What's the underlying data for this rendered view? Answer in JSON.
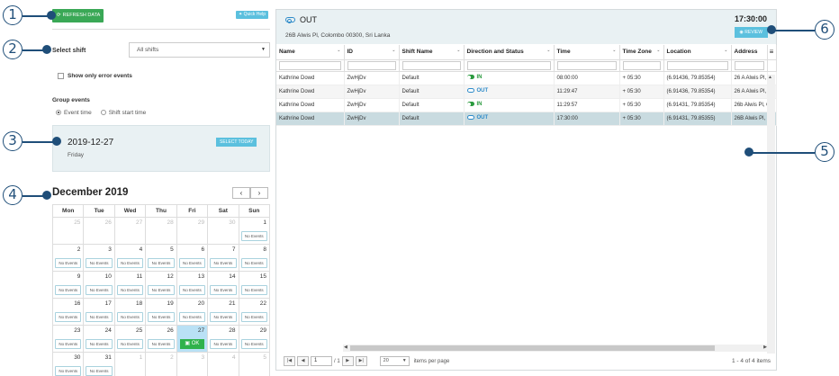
{
  "callouts": [
    "1",
    "2",
    "3",
    "4",
    "5",
    "6"
  ],
  "left": {
    "refresh_label": "REFRESH DATA",
    "quick_help_label": "Quick Help",
    "select_shift_label": "Select shift",
    "select_shift_value": "All shifts",
    "show_errors_label": "Show only error events",
    "group_events_label": "Group events",
    "radio_event_time": "Event time",
    "radio_shift_start": "Shift start time",
    "selected_date": "2019-12-27",
    "selected_weekday": "Friday",
    "select_today_label": "SELECT TODAY"
  },
  "calendar": {
    "title": "December 2019",
    "prev_label": "‹",
    "next_label": "›",
    "weekdays": [
      "Mon",
      "Tue",
      "Wed",
      "Thu",
      "Fri",
      "Sat",
      "Sun"
    ],
    "no_events_label": "No Events",
    "ok_label": "OK",
    "weeks": [
      [
        {
          "d": "25",
          "out": true
        },
        {
          "d": "26",
          "out": true
        },
        {
          "d": "27",
          "out": true
        },
        {
          "d": "28",
          "out": true
        },
        {
          "d": "29",
          "out": true
        },
        {
          "d": "30",
          "out": true
        },
        {
          "d": "1",
          "ne": true
        }
      ],
      [
        {
          "d": "2",
          "ne": true
        },
        {
          "d": "3",
          "ne": true
        },
        {
          "d": "4",
          "ne": true
        },
        {
          "d": "5",
          "ne": true
        },
        {
          "d": "6",
          "ne": true
        },
        {
          "d": "7",
          "ne": true
        },
        {
          "d": "8",
          "ne": true
        }
      ],
      [
        {
          "d": "9",
          "ne": true
        },
        {
          "d": "10",
          "ne": true
        },
        {
          "d": "11",
          "ne": true
        },
        {
          "d": "12",
          "ne": true
        },
        {
          "d": "13",
          "ne": true
        },
        {
          "d": "14",
          "ne": true
        },
        {
          "d": "15",
          "ne": true
        }
      ],
      [
        {
          "d": "16",
          "ne": true
        },
        {
          "d": "17",
          "ne": true
        },
        {
          "d": "18",
          "ne": true
        },
        {
          "d": "19",
          "ne": true
        },
        {
          "d": "20",
          "ne": true
        },
        {
          "d": "21",
          "ne": true
        },
        {
          "d": "22",
          "ne": true
        }
      ],
      [
        {
          "d": "23",
          "ne": true
        },
        {
          "d": "24",
          "ne": true
        },
        {
          "d": "25",
          "ne": true
        },
        {
          "d": "26",
          "ne": true
        },
        {
          "d": "27",
          "sel": true,
          "ok": true
        },
        {
          "d": "28",
          "ne": true
        },
        {
          "d": "29",
          "ne": true
        }
      ],
      [
        {
          "d": "30",
          "ne": true
        },
        {
          "d": "31",
          "ne": true
        },
        {
          "d": "1",
          "out": true
        },
        {
          "d": "2",
          "out": true
        },
        {
          "d": "3",
          "out": true
        },
        {
          "d": "4",
          "out": true
        },
        {
          "d": "5",
          "out": true
        }
      ]
    ]
  },
  "detail": {
    "status": "OUT",
    "address": "26B Alwis Pl, Colombo 00300, Sri Lanka",
    "time": "17:30:00",
    "review_label": "REVIEW"
  },
  "grid": {
    "columns": [
      "Name",
      "ID",
      "Shift Name",
      "Direction and Status",
      "Time",
      "Time Zone",
      "Location",
      "Address"
    ],
    "menu_icon": "≡",
    "rows": [
      {
        "name": "Kathrine Dowd",
        "id": "ZwHjDv",
        "shift": "Default",
        "dir": "IN",
        "time": "08:00:00",
        "tz": "+ 05:30",
        "loc": "(6.91436, 79.85354)",
        "addr": "26 A Alwis Pl, C"
      },
      {
        "name": "Kathrine Dowd",
        "id": "ZwHjDv",
        "shift": "Default",
        "dir": "OUT",
        "time": "11:29:47",
        "tz": "+ 05:30",
        "loc": "(6.91436, 79.85354)",
        "addr": "26 A Alwis Pl, C"
      },
      {
        "name": "Kathrine Dowd",
        "id": "ZwHjDv",
        "shift": "Default",
        "dir": "IN",
        "time": "11:29:57",
        "tz": "+ 05:30",
        "loc": "(6.91431, 79.85354)",
        "addr": "26b Alwis Pl, C"
      },
      {
        "name": "Kathrine Dowd",
        "id": "ZwHjDv",
        "shift": "Default",
        "dir": "OUT",
        "time": "17:30:00",
        "tz": "+ 05:30",
        "loc": "(6.91431, 79.85355)",
        "addr": "26B Alwis Pl, C"
      }
    ]
  },
  "pager": {
    "first": "|◀",
    "prev": "◀",
    "page": "1",
    "of": "/ 1",
    "next": "▶",
    "last": "▶|",
    "page_size": "20",
    "per_page_label": "items per page",
    "info": "1 - 4 of 4 items"
  },
  "colors": {
    "accent": "#5bc0de",
    "green": "#3aa856",
    "callout": "#1f4e79"
  }
}
